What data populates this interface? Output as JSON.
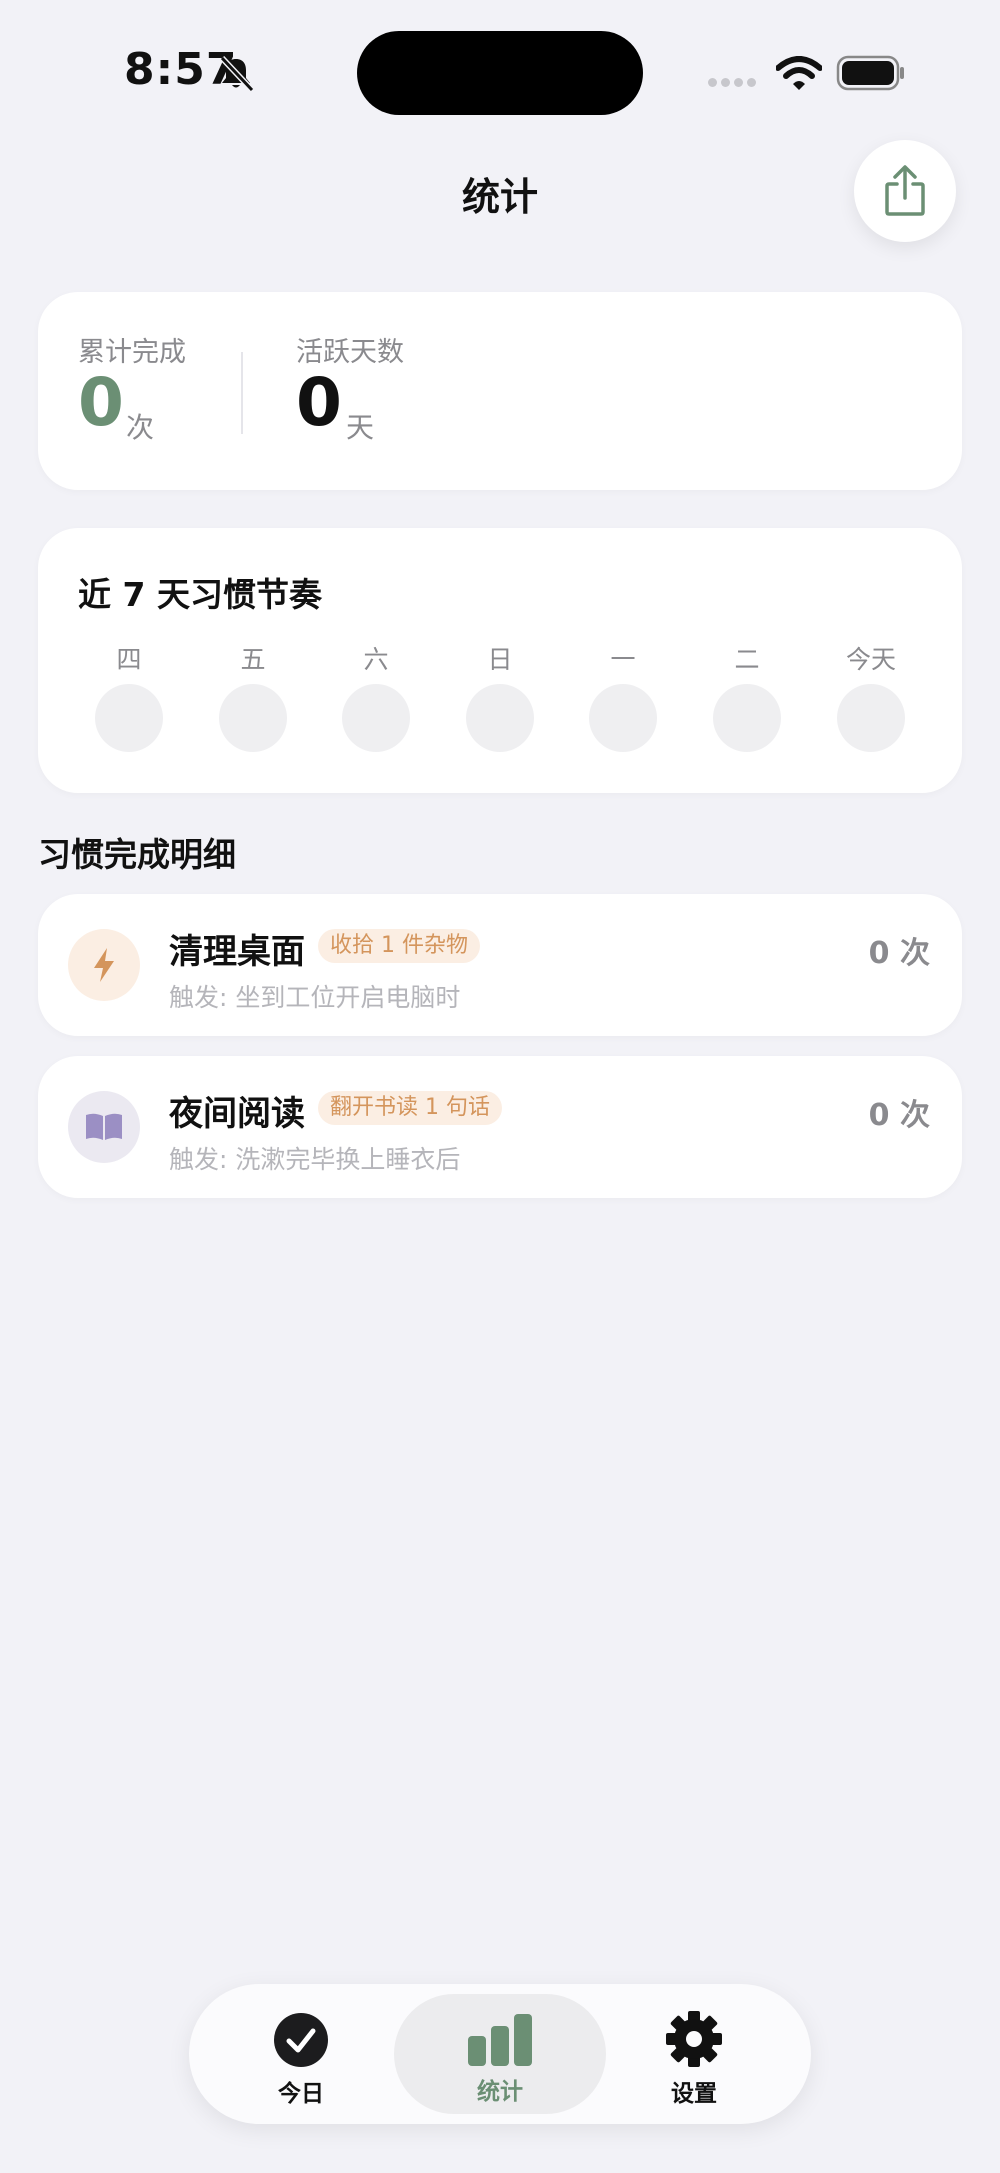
{
  "status_bar": {
    "time": "8:57"
  },
  "header": {
    "title": "统计"
  },
  "summary": {
    "total_label": "累计完成",
    "total_value": "0",
    "total_unit": "次",
    "active_label": "活跃天数",
    "active_value": "0",
    "active_unit": "天"
  },
  "week": {
    "title": "近 7 天习惯节奏",
    "days": [
      "四",
      "五",
      "六",
      "日",
      "一",
      "二",
      "今天"
    ]
  },
  "details": {
    "title": "习惯完成明细",
    "habits": [
      {
        "name": "清理桌面",
        "tag": "收拾 1 件杂物",
        "trigger": "触发: 坐到工位开启电脑时",
        "count": "0 次",
        "icon": "lightning-icon"
      },
      {
        "name": "夜间阅读",
        "tag": "翻开书读 1 句话",
        "trigger": "触发: 洗漱完毕换上睡衣后",
        "count": "0 次",
        "icon": "book-icon"
      }
    ]
  },
  "tabs": [
    {
      "label": "今日",
      "icon": "check-circle-icon"
    },
    {
      "label": "统计",
      "icon": "bar-chart-icon",
      "active": true
    },
    {
      "label": "设置",
      "icon": "gear-icon"
    }
  ],
  "colors": {
    "accent_green": "#6b8f74",
    "tag_orange": "#d4955c",
    "book_purple": "#9b8fc4"
  }
}
